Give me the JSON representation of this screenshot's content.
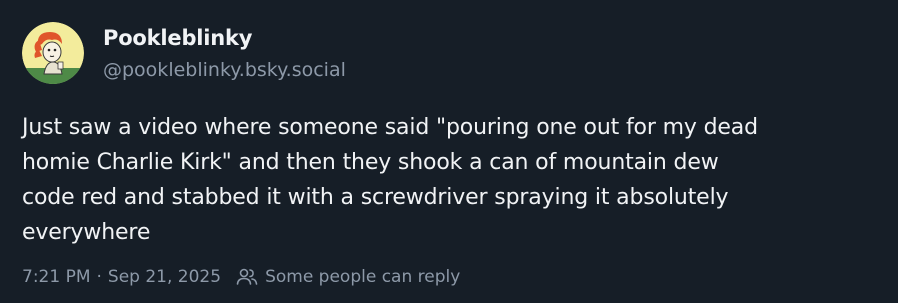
{
  "post": {
    "author": {
      "display_name": "Pookleblinky",
      "handle": "@pookleblinky.bsky.social"
    },
    "text_lines": [
      "Just saw a video where someone said \"pouring one out for my dead",
      "homie Charlie Kirk\" and then they shook a can of mountain dew",
      "code red and stabbed it with a screwdriver spraying it absolutely",
      "everywhere"
    ],
    "time": "7:21 PM",
    "separator": "·",
    "date": "Sep 21, 2025",
    "reply_setting": "Some people can reply",
    "reply_icon": "people-icon"
  },
  "colors": {
    "background": "#161e27",
    "text_primary": "#f1f3f5",
    "text_secondary": "#8d99a8",
    "avatar_bg": "#f3ec9c"
  }
}
